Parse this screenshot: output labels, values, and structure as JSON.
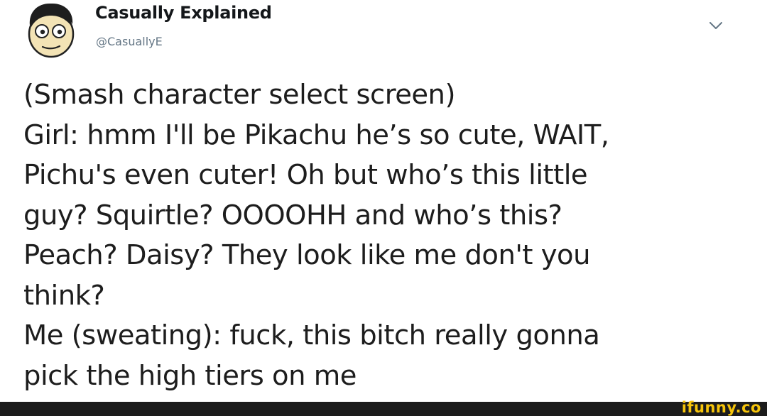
{
  "tweet": {
    "author_name": "Casually Explained",
    "author_handle": "@CasuallyE",
    "more_icon": "chevron-down-icon",
    "lines": [
      "(Smash character select screen)",
      "Girl: hmm I'll be Pikachu he’s so cute, WAIT,",
      "Pichu's even cuter! Oh but who’s this little",
      "guy? Squirtle? OOOOHH and who’s this?",
      "Peach? Daisy? They look like me don't you",
      "think?",
      "Me (sweating): fuck, this bitch really gonna",
      "pick the high tiers on me"
    ]
  },
  "footer": {
    "watermark": "ifunny.co",
    "watermark_color": "#f6c40a",
    "bar_color": "#1c1c1c"
  }
}
